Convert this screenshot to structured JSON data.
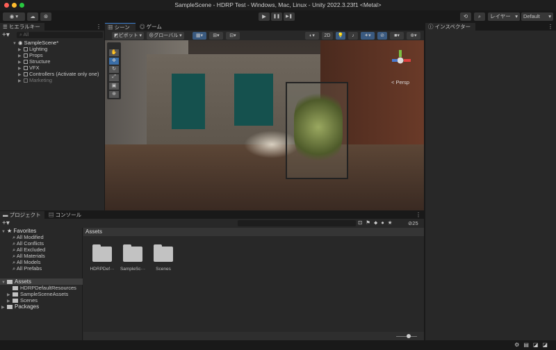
{
  "window": {
    "title": "SampleScene - HDRP Test - Windows, Mac, Linux - Unity 2022.3.23f1 <Metal>"
  },
  "toolbar": {
    "layers_label": "レイヤー",
    "layout_label": "Default",
    "play": "▶",
    "pause": "❚❚",
    "step": "▶❚"
  },
  "hierarchy": {
    "tab": "ヒエラルキー",
    "search_placeholder": "All",
    "scene": "SampleScene*",
    "items": [
      {
        "label": "Lighting"
      },
      {
        "label": "Props"
      },
      {
        "label": "Structure"
      },
      {
        "label": "VFX"
      },
      {
        "label": "Controllers (Activate only one)"
      },
      {
        "label": "Marketing"
      }
    ]
  },
  "scene": {
    "tabs": [
      "シーン",
      "ゲーム"
    ],
    "pivot_label": "ピボット",
    "global_label": "グローバル",
    "mode_2d": "2D",
    "persp_label": "< Persp"
  },
  "inspector": {
    "tab": "インスペクター"
  },
  "project": {
    "tabs": [
      "プロジェクト",
      "コンソール"
    ],
    "favorites_label": "Favorites",
    "favorites": [
      "All Modified",
      "All Conflicts",
      "All Excluded",
      "All Materials",
      "All Models",
      "All Prefabs"
    ],
    "assets_label": "Assets",
    "asset_children": [
      "HDRPDefaultResources",
      "SampleSceneAssets",
      "Scenes"
    ],
    "packages_label": "Packages",
    "breadcrumb": "Assets",
    "grid_items": [
      "HDRPDef···",
      "SampleSc···",
      "Scenes"
    ],
    "hidden_count": "25"
  }
}
